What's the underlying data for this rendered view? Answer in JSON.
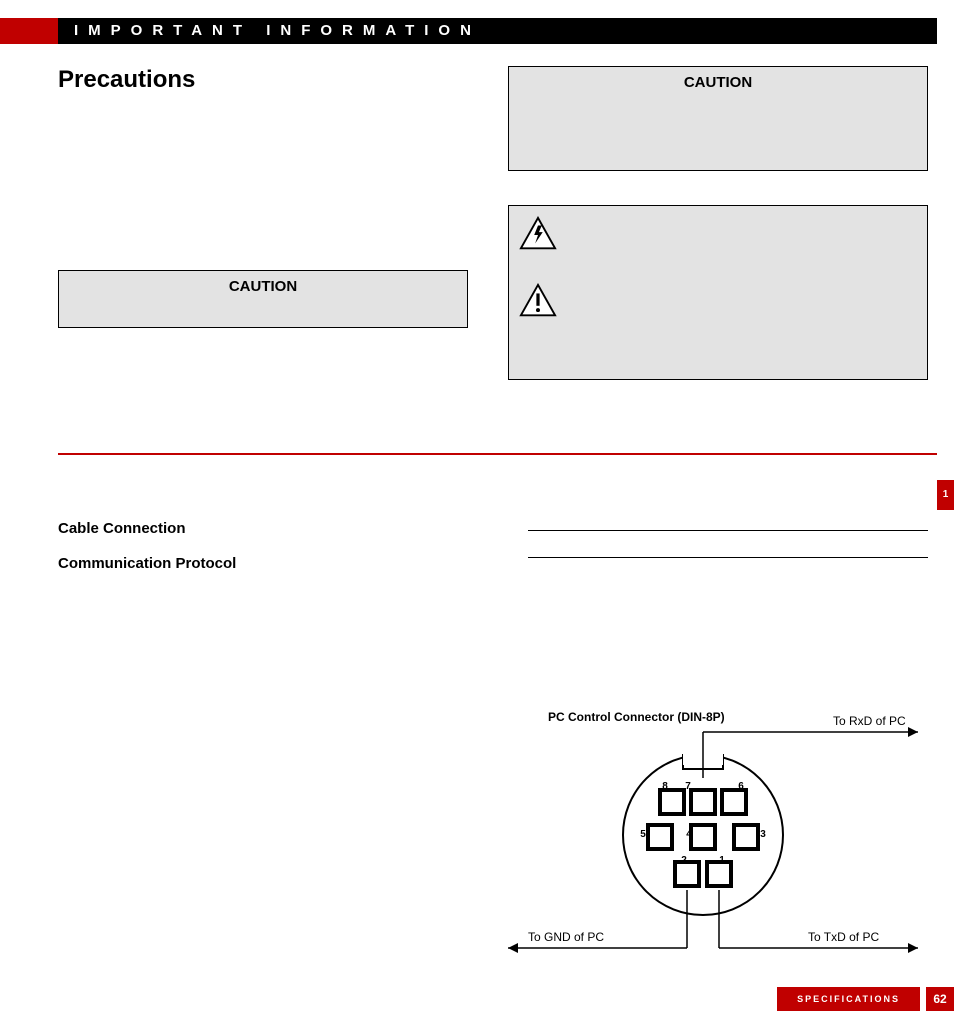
{
  "header": {
    "title": "IMPORTANT INFORMATION"
  },
  "section_title": "Precautions",
  "caution_left": {
    "title": "CAUTION"
  },
  "caution_right": {
    "title": "CAUTION"
  },
  "subheadings": {
    "cable": "Cable Connection",
    "protocol": "Communication Protocol"
  },
  "diagram": {
    "title": "PC Control Connector (DIN-8P)",
    "to_rxd": "To RxD of PC",
    "to_txd": "To TxD of PC",
    "to_gnd": "To GND of PC",
    "pins": {
      "p1": "1",
      "p2": "2",
      "p3": "3",
      "p4": "4",
      "p5": "5",
      "p6": "6",
      "p7": "7",
      "p8": "8"
    }
  },
  "footer": {
    "label": "SPECIFICATIONS",
    "page": "62"
  },
  "side_tab": "1"
}
